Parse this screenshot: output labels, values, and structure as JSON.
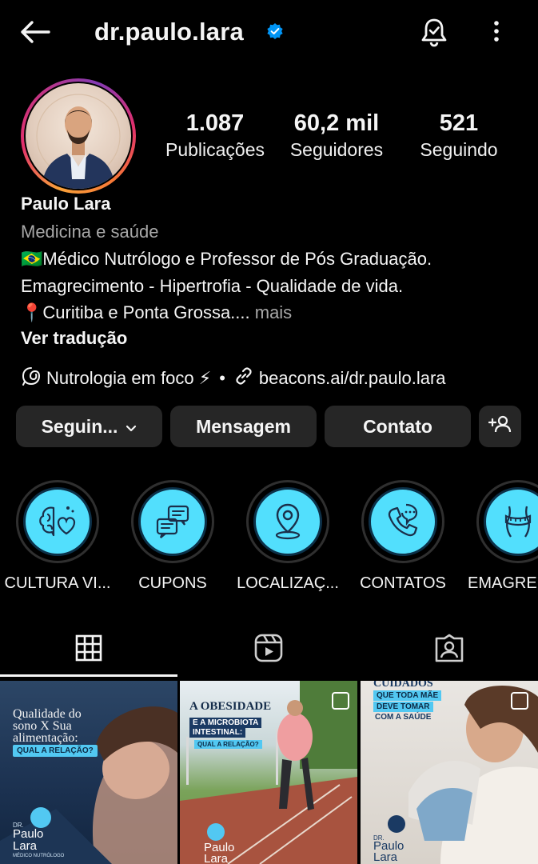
{
  "header": {
    "username": "dr.paulo.lara",
    "icons": [
      "back-arrow-icon",
      "verified-badge-icon",
      "notification-bell-icon",
      "more-options-icon"
    ]
  },
  "stats": [
    {
      "value": "1.087",
      "label": "Publicações"
    },
    {
      "value": "60,2 mil",
      "label": "Seguidores"
    },
    {
      "value": "521",
      "label": "Seguindo"
    }
  ],
  "bio": {
    "name": "Paulo Lara",
    "category": "Medicina e saúde",
    "line1": "🇧🇷Médico Nutrólogo e Professor de Pós Graduação.",
    "line2": "Emagrecimento - Hipertrofia - Qualidade de vida.",
    "line3": "📍Curitiba e Ponta Grossa....",
    "more": " mais",
    "translate": "Ver tradução",
    "thread_link": "Nutrologia em foco ⚡",
    "separator": "•",
    "website": "beacons.ai/dr.paulo.lara"
  },
  "actions": {
    "following": "Seguin...",
    "message": "Mensagem",
    "contact": "Contato"
  },
  "highlights": [
    {
      "label": "CULTURA VI...",
      "icon": "brain-heart-icon"
    },
    {
      "label": "CUPONS",
      "icon": "chat-bubbles-icon"
    },
    {
      "label": "LOCALIZAÇ...",
      "icon": "location-pin-icon"
    },
    {
      "label": "CONTATOS",
      "icon": "phone-icon"
    },
    {
      "label": "EMAGRE",
      "icon": "body-measure-icon"
    }
  ],
  "tabs": [
    "grid-icon",
    "reels-icon",
    "tagged-icon"
  ],
  "posts": [
    {
      "title": "Qualidade do sono X Sua alimentação:",
      "tag": "QUAL A RELAÇÃO?",
      "brand": "Paulo Lara",
      "brand_small": "DR.",
      "brand_sub": "MÉDICO NUTRÓLOGO"
    },
    {
      "title": "A OBESIDADE",
      "sub1": "E A MICROBIOTA",
      "sub2": "INTESTINAL:",
      "tag": "QUAL A RELAÇÃO?",
      "brand": "Paulo Lara"
    },
    {
      "title": "CUIDADOS",
      "sub1": "QUE TODA MÃE",
      "sub2": "DEVE TOMAR",
      "sub3": "COM A SAÚDE",
      "brand": "Paulo Lara",
      "brand_small": "DR."
    }
  ],
  "colors": {
    "background": "#000000",
    "button": "#262626",
    "highlight": "#52dffd",
    "verified": "#0095f6",
    "muted": "#a8a8a8"
  }
}
